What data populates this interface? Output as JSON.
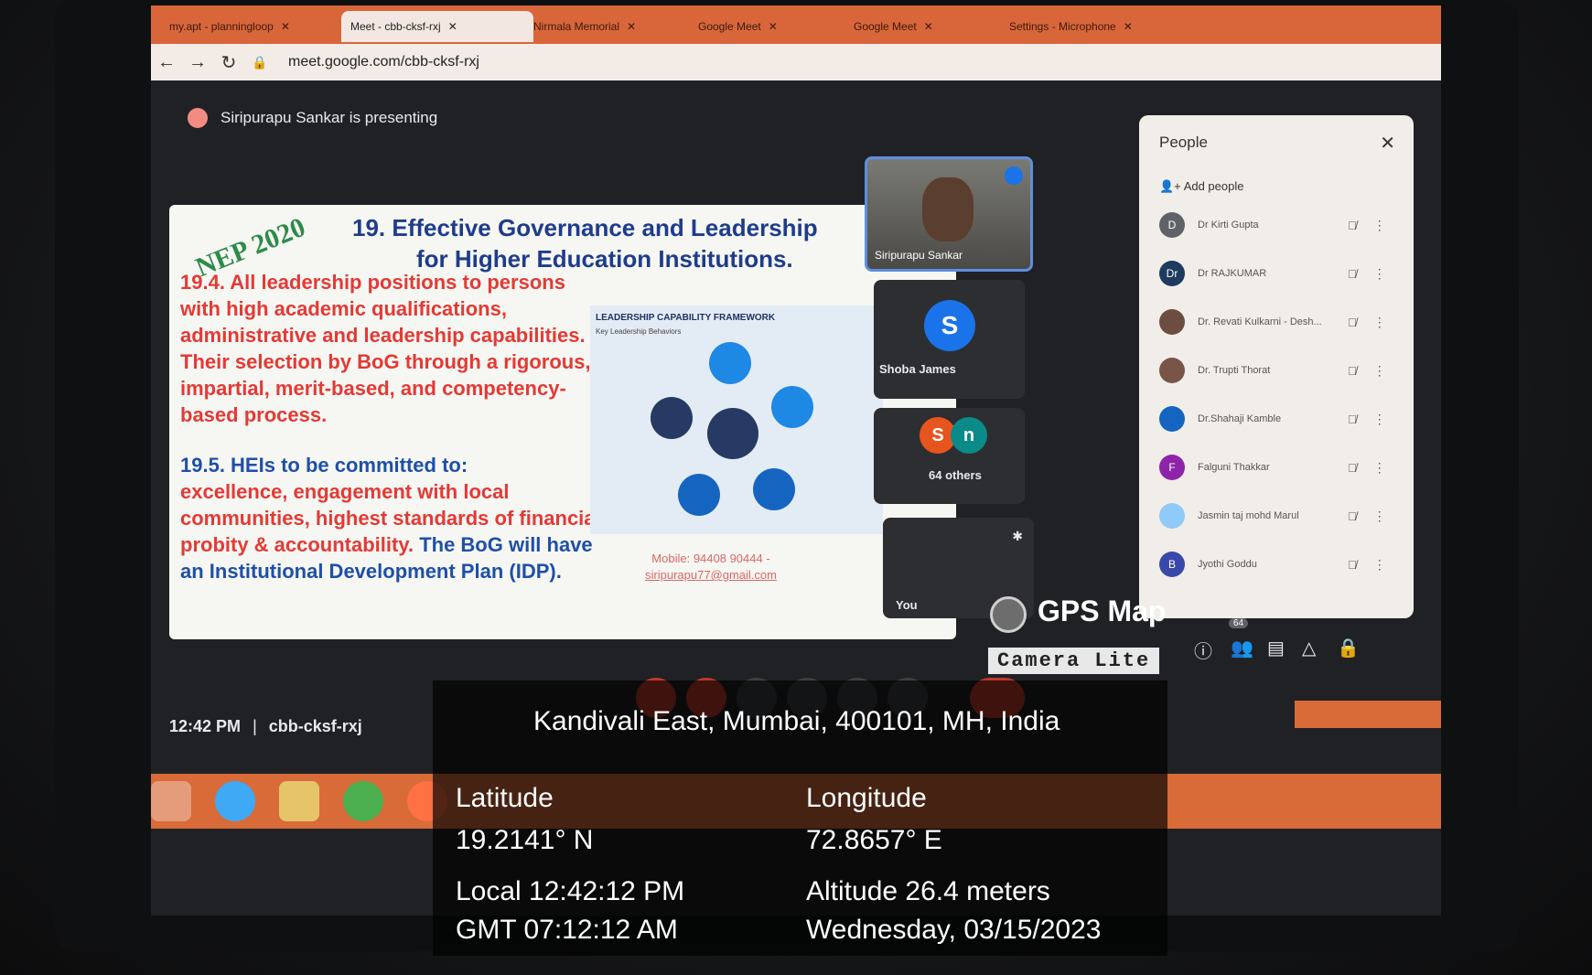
{
  "browser": {
    "tabs": [
      {
        "label": "my.apt - planningloop",
        "active": false
      },
      {
        "label": "Meet - cbb-cksf-rxj",
        "active": true
      },
      {
        "label": "Nirmala Memorial",
        "active": false
      },
      {
        "label": "Google Meet",
        "active": false
      },
      {
        "label": "Google Meet",
        "active": false
      },
      {
        "label": "Settings - Microphone",
        "active": false
      }
    ],
    "url": "meet.google.com/cbb-cksf-rxj"
  },
  "meet": {
    "presenting": "Siripurapu Sankar is presenting",
    "meeting_time": "12:42 PM",
    "separator": "|",
    "meeting_code": "cbb-cksf-rxj",
    "tiles": {
      "speaker_name": "Siripurapu Sankar",
      "shoba_initial": "S",
      "shoba_name": "Shoba James",
      "others_initials": [
        "S",
        "n"
      ],
      "others_label": "64 others",
      "you_label": "You"
    },
    "people_panel": {
      "title": "People",
      "add_label": "Add people",
      "participants": [
        {
          "initial": "D",
          "name": "Dr Kirti Gupta",
          "color": "#5f6368"
        },
        {
          "initial": "Dr",
          "name": "Dr RAJKUMAR",
          "color": "#1e3a5f"
        },
        {
          "initial": "",
          "name": "Dr. Revati Kulkarni - Desh...",
          "color": "#6d4c41"
        },
        {
          "initial": "",
          "name": "Dr. Trupti Thorat",
          "color": "#795548"
        },
        {
          "initial": "",
          "name": "Dr.Shahaji Kamble",
          "color": "#1565c0"
        },
        {
          "initial": "F",
          "name": "Falguni Thakkar",
          "color": "#8e24aa"
        },
        {
          "initial": "",
          "name": "Jasmin taj mohd Marul",
          "color": "#90caf9"
        },
        {
          "initial": "B",
          "name": "Jyothi Goddu",
          "color": "#3949ab"
        }
      ],
      "people_count": "64"
    }
  },
  "slide": {
    "badge": "NEP 2020",
    "title_line1": "19. Effective Governance and Leadership",
    "title_line2": "for Higher Education Institutions.",
    "para_194": "19.4. All leadership positions  to persons with high academic qualifications, administrative and leadership capabilities. Their  selection  by  BoG through a rigorous, impartial, merit-based, and competency-based process.",
    "para_195_head": "19.5. HEIs to be committed to:",
    "para_195_red": "excellence, engagement with  local communities,  highest standards of financial probity & accountability.",
    "para_195_blue": "The BoG will have an Institutional Development Plan (IDP).",
    "framework_title": "LEADERSHIP CAPABILITY FRAMEWORK",
    "framework_sub": "Key Leadership Behaviors",
    "contact_mobile": "Mobile: 94408 90444 -",
    "contact_email": "siripurapu77@gmail.com"
  },
  "overlay": {
    "location": "Kandivali East, Mumbai, 400101, MH, India",
    "latitude_label": "Latitude",
    "latitude_value": "19.2141° N",
    "longitude_label": "Longitude",
    "longitude_value": "72.8657° E",
    "local_time": "Local 12:42:12 PM",
    "gmt_time": "GMT 07:12:12 AM",
    "altitude": "Altitude  26.4 meters",
    "date": "Wednesday, 03/15/2023",
    "brand_line1": "GPS Map",
    "brand_line2": "Camera Lite"
  },
  "colors": {
    "taskbar": "#d96b38",
    "slide_blue": "#1f4fa8",
    "slide_red": "#e53935",
    "meet_bg": "#202124"
  }
}
